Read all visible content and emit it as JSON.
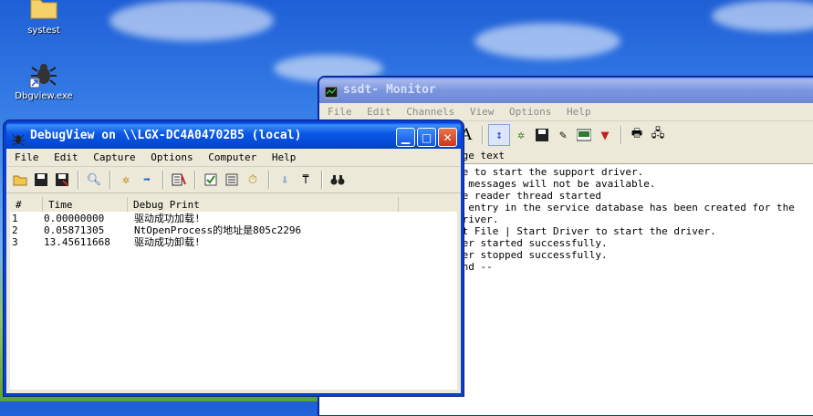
{
  "desktop": {
    "icons": [
      {
        "label": "systest"
      },
      {
        "label": "Dbgview.exe"
      }
    ]
  },
  "monitor": {
    "title": "ssdt- Monitor",
    "menu": [
      "File",
      "Edit",
      "Channels",
      "View",
      "Options",
      "Help"
    ],
    "header": "age text",
    "lines": [
      "le to start the support driver.",
      "l messages will not be available.",
      "te reader thread started",
      "w entry in the service database has been created for the driver.",
      "ct File | Start Driver to start the driver.",
      "ver started successfully.",
      "ver stopped successfully.",
      "end --"
    ]
  },
  "debugview": {
    "title": "DebugView on \\\\LGX-DC4A04702B5 (local)",
    "menu": [
      "File",
      "Edit",
      "Capture",
      "Options",
      "Computer",
      "Help"
    ],
    "columns": [
      "#",
      "Time",
      "Debug Print"
    ],
    "rows": [
      {
        "num": "1",
        "time": "0.00000000",
        "text": "驱动成功加载!"
      },
      {
        "num": "2",
        "time": "0.05871305",
        "text": "NtOpenProcess的地址是805c2296"
      },
      {
        "num": "3",
        "time": "13.45611668",
        "text": "驱动成功卸载!"
      }
    ]
  },
  "colors": {
    "title_active": "#0a58e6",
    "title_inactive": "#7b96e0",
    "window_bg": "#ece9d8"
  }
}
